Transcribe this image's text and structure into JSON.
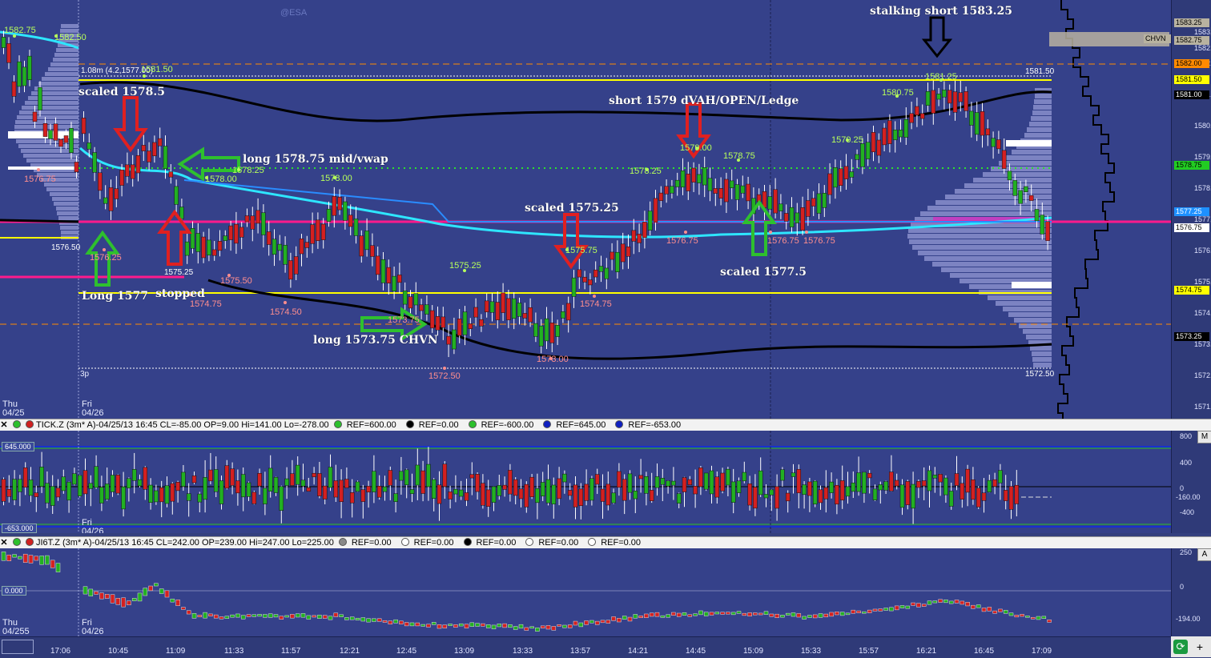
{
  "symbol_watermark": "@ESA",
  "main": {
    "yaxis_ticks": [
      "1583.00",
      "1582.50",
      "1582.00",
      "1581.00",
      "1580.00",
      "1579.00",
      "1578.00",
      "1577.00",
      "1576.00",
      "1575.00",
      "1574.00",
      "1573.00",
      "1572.00",
      "1571.00"
    ],
    "price_tags": [
      {
        "label": "CHVN",
        "color": "#b8b2a0"
      },
      {
        "label": "1583.25",
        "color": "#b8b2a0"
      },
      {
        "label": "1582.75",
        "color": "#b8b2a0"
      },
      {
        "label": "1582.00",
        "color": "#ff8a00"
      },
      {
        "label": "1581.50",
        "color": "#ffff00"
      },
      {
        "label": "1581.00",
        "color": "#000000"
      },
      {
        "label": "1578.75",
        "color": "#22cc22"
      },
      {
        "label": "1577.25",
        "color": "#1e90ff"
      },
      {
        "label": "1576.75",
        "color": "#ffffff"
      },
      {
        "label": "1574.75",
        "color": "#ffff00"
      },
      {
        "label": "1573.25",
        "color": "#000000"
      }
    ],
    "annotations": {
      "stalking": "stalking short 1583.25",
      "scaled1": "scaled 1578.5",
      "long1": "long 1578.75 mid/vwap",
      "short1": "short 1579 dVAH/OPEN/Ledge",
      "scaled2": "scaled 1575.25",
      "scaled3": "scaled 1577.5",
      "long2": "Long 1577",
      "stopped": "stopped",
      "long3": "long 1573.75 CHVN"
    },
    "price_labels": {
      "p1": "1582.75",
      "p2": "1582.50",
      "p3": "1581.50",
      "p4": "1578.25",
      "p5": "1578.00",
      "p6": "1578.00",
      "p7": "1575.25",
      "p8": "1578.25",
      "p9": "1579.00",
      "p10": "1578.75",
      "p11": "1579.25",
      "p12": "1580.75",
      "p13": "1581.25",
      "p14": "1576.75",
      "p15": "1576.25",
      "p16": "1574.75",
      "p17": "1575.50",
      "p18": "1574.50",
      "p19": "1573.75",
      "p20": "1572.50",
      "p21": "1573.00",
      "p22": "1574.75",
      "p23": "1576.75",
      "p24": "1576.75",
      "p25": "1576.75",
      "p26": "1575.25",
      "p27": "1578.00",
      "p28": "1576.50",
      "p29": "1581.50",
      "p30": "1572.50",
      "p31": "1575.75"
    },
    "range_info": "1.08m (4.2,1577.00)"
  },
  "tick": {
    "header": "TICK.Z (3m* A)-04/25/13 16:45 CL=-85.00 OP=9.00 Hi=141.00 Lo=-278.00",
    "refs": [
      {
        "text": "REF=600.00",
        "color": "#2cc02c"
      },
      {
        "text": "REF=0.00",
        "color": "#000000"
      },
      {
        "text": "REF=-600.00",
        "color": "#2cc02c"
      },
      {
        "text": "REF=645.00",
        "color": "#1020c0"
      },
      {
        "text": "REF=-653.00",
        "color": "#1020c0"
      }
    ],
    "yaxis_ticks": [
      "800",
      "400",
      "0",
      "-400"
    ],
    "box_top": "645.000",
    "box_bottom": "-653.000",
    "last": "-160.00"
  },
  "ji": {
    "header": "JI6T.Z (3m* A)-04/25/13 16:45 CL=242.00 OP=239.00 Hi=247.00 Lo=225.00",
    "refs": [
      {
        "text": "REF=0.00",
        "color": "#888888"
      },
      {
        "text": "REF=0.00",
        "color": "#ffffff"
      },
      {
        "text": "REF=0.00",
        "color": "#000000"
      },
      {
        "text": "REF=0.00",
        "color": "#ffffff"
      },
      {
        "text": "REF=0.00",
        "color": "#ffffff"
      }
    ],
    "yaxis_ticks": [
      "250",
      "0"
    ],
    "box_mid": "0.000",
    "last": "-194.00"
  },
  "dates": {
    "thu_day": "Thu",
    "thu_date": "04/25",
    "thu_date2": "04/255",
    "fri_day": "Fri",
    "fri_date": "04/26"
  },
  "time_ticks": [
    "17:06",
    "10:45",
    "11:09",
    "11:33",
    "11:57",
    "12:21",
    "12:45",
    "13:09",
    "13:33",
    "13:57",
    "14:21",
    "14:45",
    "15:09",
    "15:33",
    "15:57",
    "16:21",
    "16:45",
    "17:09"
  ],
  "corner": {
    "m": "M",
    "a": "A",
    "plus": "+"
  }
}
